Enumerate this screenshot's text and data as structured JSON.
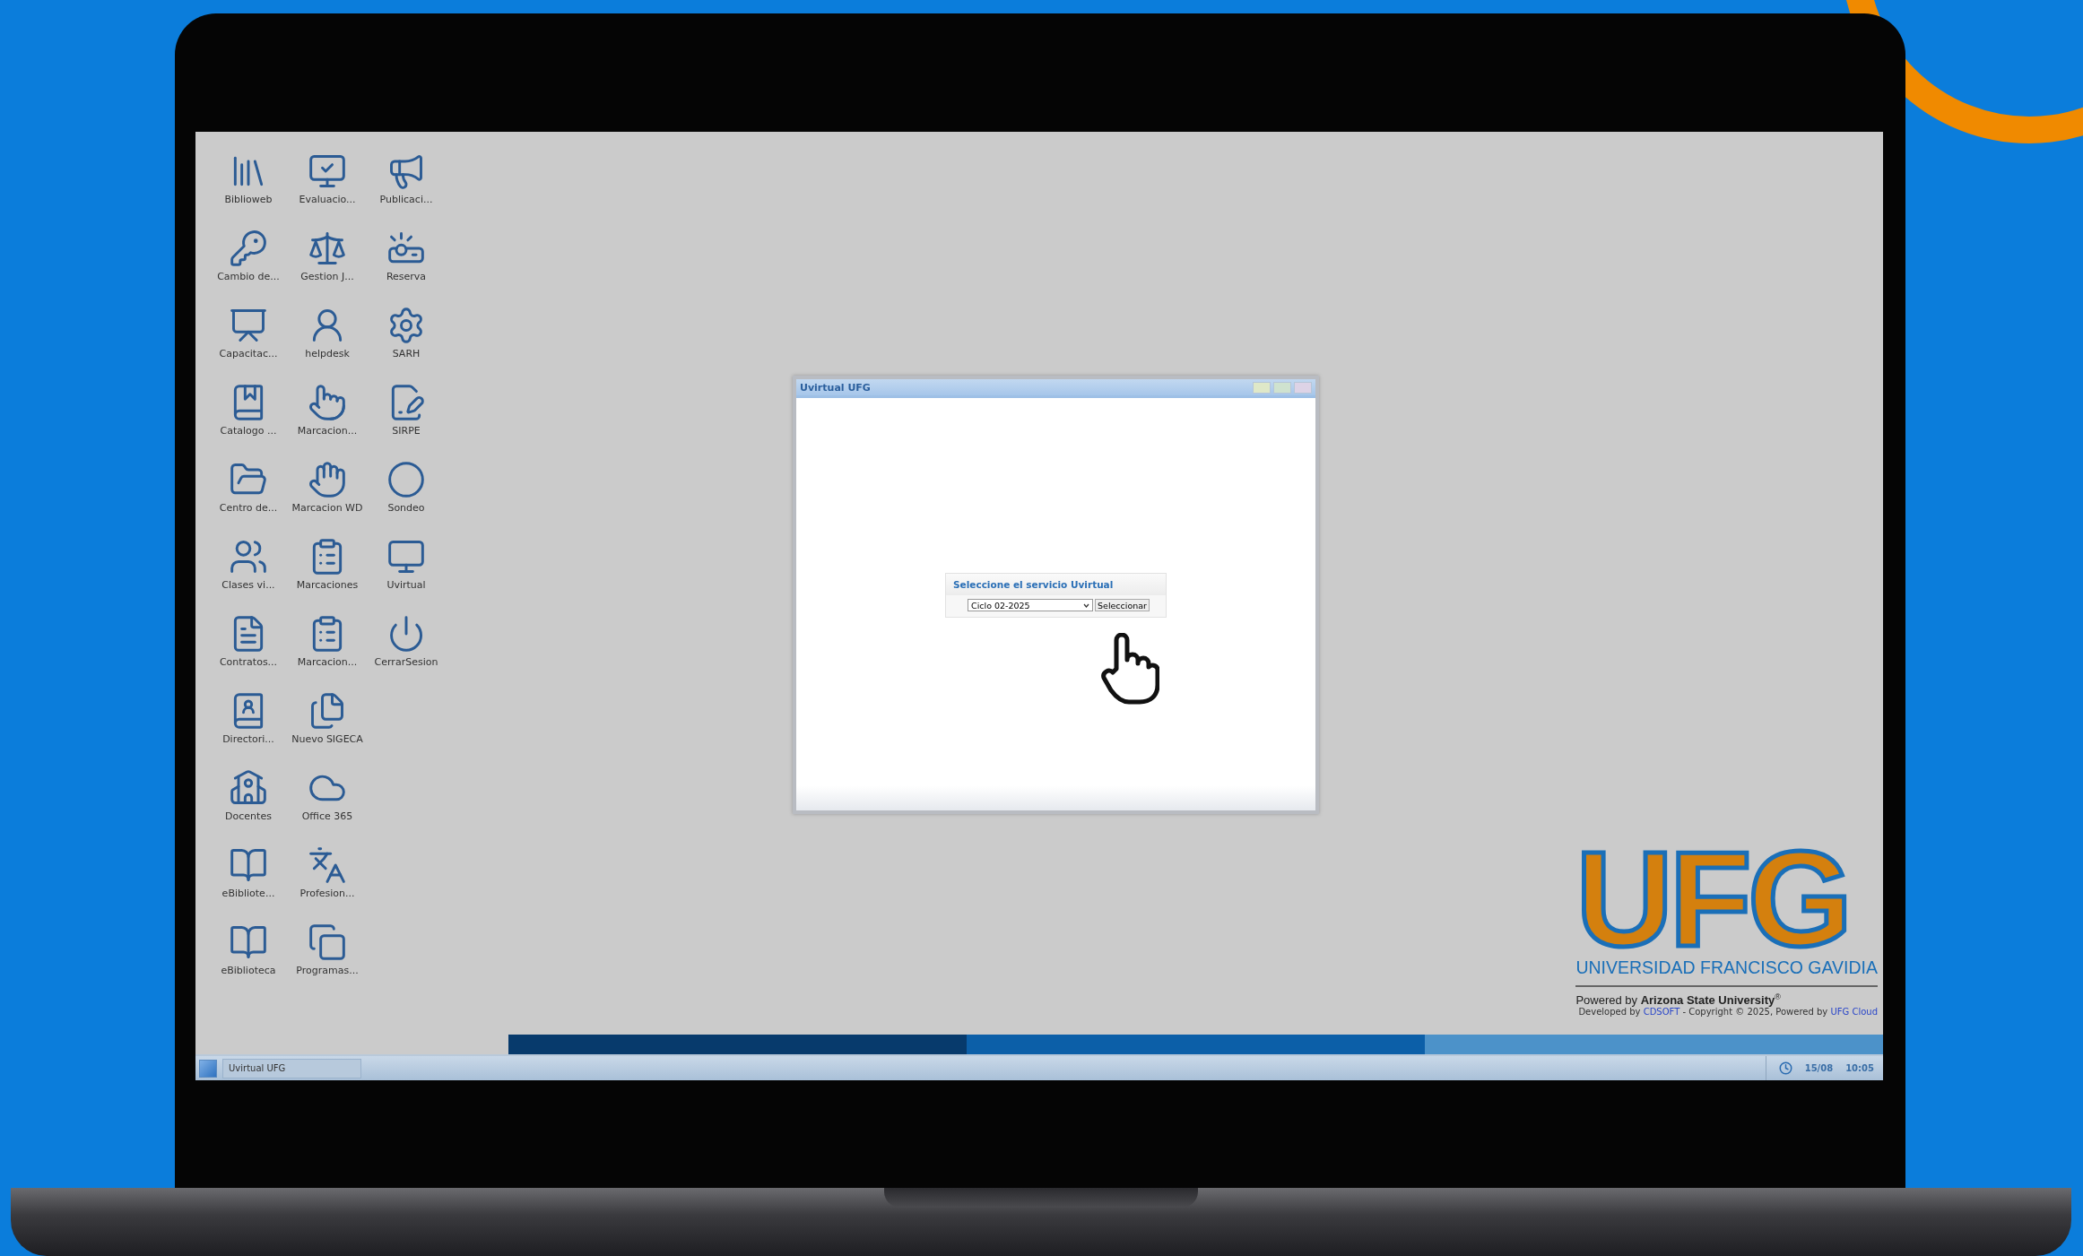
{
  "desktop_icons": [
    {
      "label": "Biblioweb"
    },
    {
      "label": "Evaluacio..."
    },
    {
      "label": "Publicaci..."
    },
    {
      "label": "Cambio de..."
    },
    {
      "label": "Gestion J..."
    },
    {
      "label": "Reserva"
    },
    {
      "label": "Capacitac..."
    },
    {
      "label": "helpdesk"
    },
    {
      "label": "SARH"
    },
    {
      "label": "Catalogo ..."
    },
    {
      "label": "Marcacion..."
    },
    {
      "label": "SIRPE"
    },
    {
      "label": "Centro de..."
    },
    {
      "label": "Marcacion WD"
    },
    {
      "label": "Sondeo"
    },
    {
      "label": "Clases vi..."
    },
    {
      "label": "Marcaciones"
    },
    {
      "label": "Uvirtual"
    },
    {
      "label": "Contratos..."
    },
    {
      "label": "Marcacion..."
    },
    {
      "label": "CerrarSesion"
    },
    {
      "label": "Directori..."
    },
    {
      "label": "Nuevo SIGECA"
    },
    {
      "label": "Docentes"
    },
    {
      "label": "Office 365"
    },
    {
      "label": "eBibliote..."
    },
    {
      "label": "Profesion..."
    },
    {
      "label": "eBiblioteca"
    },
    {
      "label": "Programas..."
    }
  ],
  "window": {
    "title": "Uvirtual UFG",
    "dialog": {
      "title": "Seleccione el servicio Uvirtual",
      "select_value": "Ciclo 02-2025",
      "button": "Seleccionar"
    }
  },
  "branding": {
    "logo": "UFG",
    "university": "UNIVERSIDAD FRANCISCO GAVIDIA",
    "powered": "Powered by **Arizona State University**$^{®}$",
    "credits": {
      "prefix": "Developed by ",
      "link_1": "CDSOFT",
      "middle": " - Copyright © 2025, Powered by ",
      "link_2": "UFG Cloud"
    }
  },
  "taskbar": {
    "tasks": [
      {
        "label": "Uvirtual UFG",
        "selected": true
      }
    ],
    "date": "15/08",
    "time": "10:05"
  }
}
